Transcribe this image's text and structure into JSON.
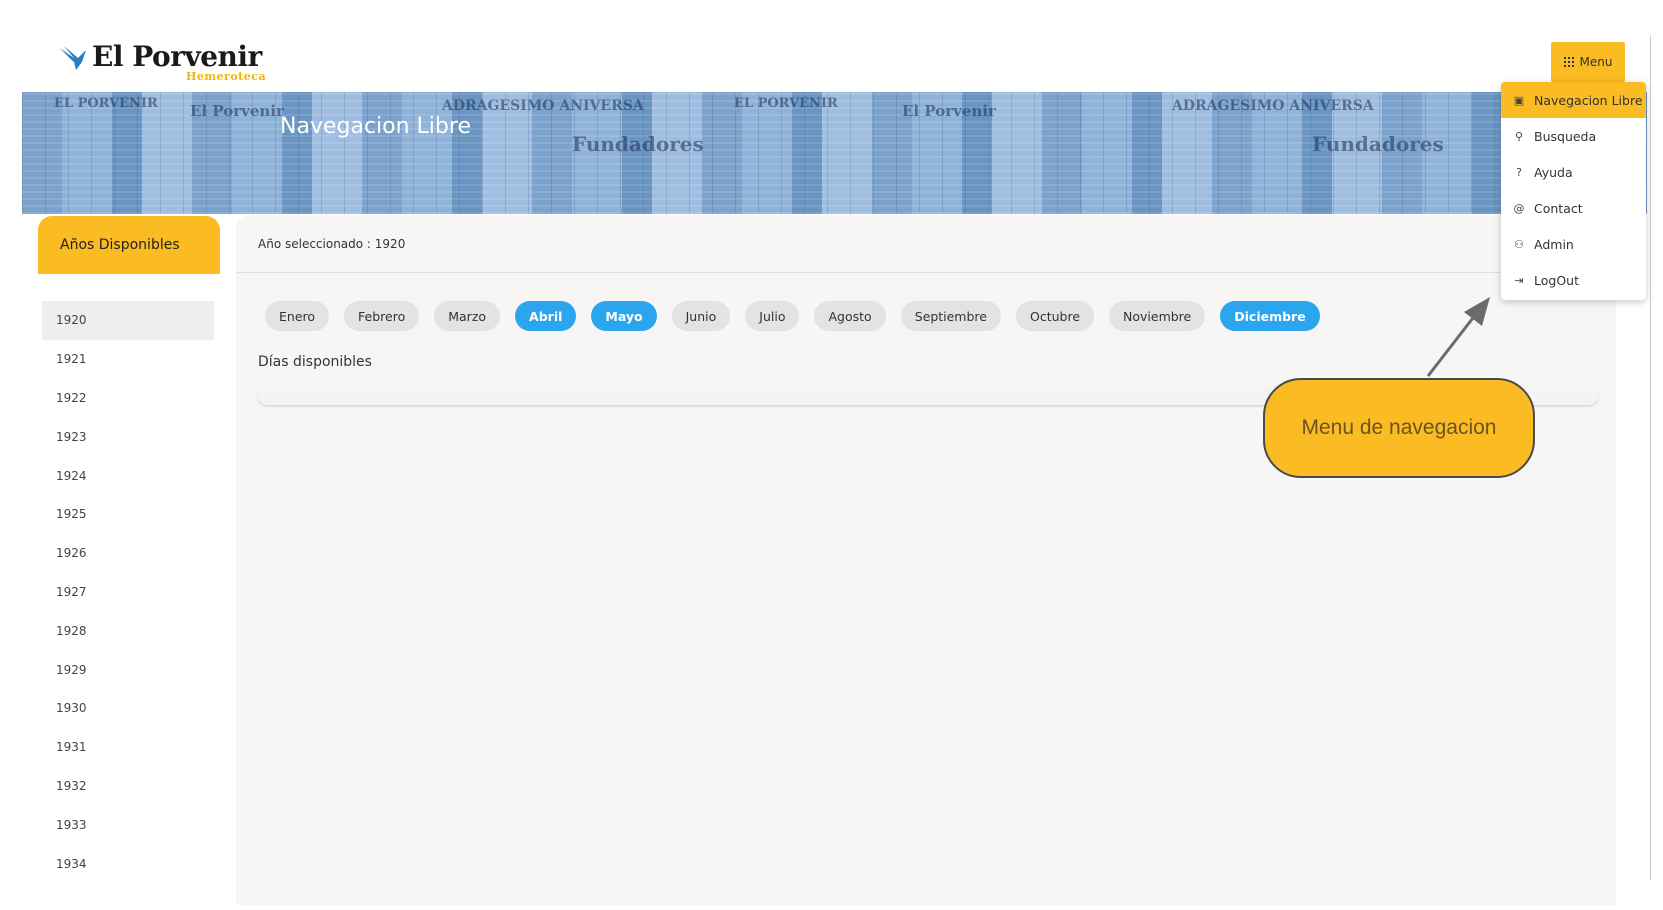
{
  "logo": {
    "title": "El Porvenir",
    "subtitle": "Hemeroteca"
  },
  "menu_button": {
    "label": "Menu",
    "icon": "grid-icon"
  },
  "banner": {
    "title": "Navegacion Libre",
    "newspaper_words": [
      "EL PORVENIR",
      "El Porvenir",
      "ADRAGESIMO ANIVERSA",
      "Fundadores"
    ]
  },
  "sidebar": {
    "tab_label": "Años Disponibles",
    "years": [
      "1920",
      "1921",
      "1922",
      "1923",
      "1924",
      "1925",
      "1926",
      "1927",
      "1928",
      "1929",
      "1930",
      "1931",
      "1932",
      "1933",
      "1934"
    ],
    "selected": "1920"
  },
  "main": {
    "selected_year_text": "Año seleccionado : 1920",
    "months": [
      {
        "label": "Enero",
        "available": false
      },
      {
        "label": "Febrero",
        "available": false
      },
      {
        "label": "Marzo",
        "available": false
      },
      {
        "label": "Abril",
        "available": true
      },
      {
        "label": "Mayo",
        "available": true
      },
      {
        "label": "Junio",
        "available": false
      },
      {
        "label": "Julio",
        "available": false
      },
      {
        "label": "Agosto",
        "available": false
      },
      {
        "label": "Septiembre",
        "available": false
      },
      {
        "label": "Octubre",
        "available": false
      },
      {
        "label": "Noviembre",
        "available": false
      },
      {
        "label": "Diciembre",
        "available": true
      }
    ],
    "days_label": "Días disponibles"
  },
  "dropdown": {
    "items": [
      {
        "label": "Navegacion Libre",
        "icon": "folder-image-icon",
        "active": true
      },
      {
        "label": "Busqueda",
        "icon": "search-icon",
        "active": false
      },
      {
        "label": "Ayuda",
        "icon": "help-icon",
        "active": false
      },
      {
        "label": "Contact",
        "icon": "at-icon",
        "active": false
      },
      {
        "label": "Admin",
        "icon": "users-icon",
        "active": false
      },
      {
        "label": "LogOut",
        "icon": "logout-icon",
        "active": false
      }
    ]
  },
  "callout": {
    "text": "Menu de navegacion"
  },
  "colors": {
    "accent": "#fbbb22",
    "month_on": "#2ba6ee",
    "banner": "#7ba2cc"
  }
}
